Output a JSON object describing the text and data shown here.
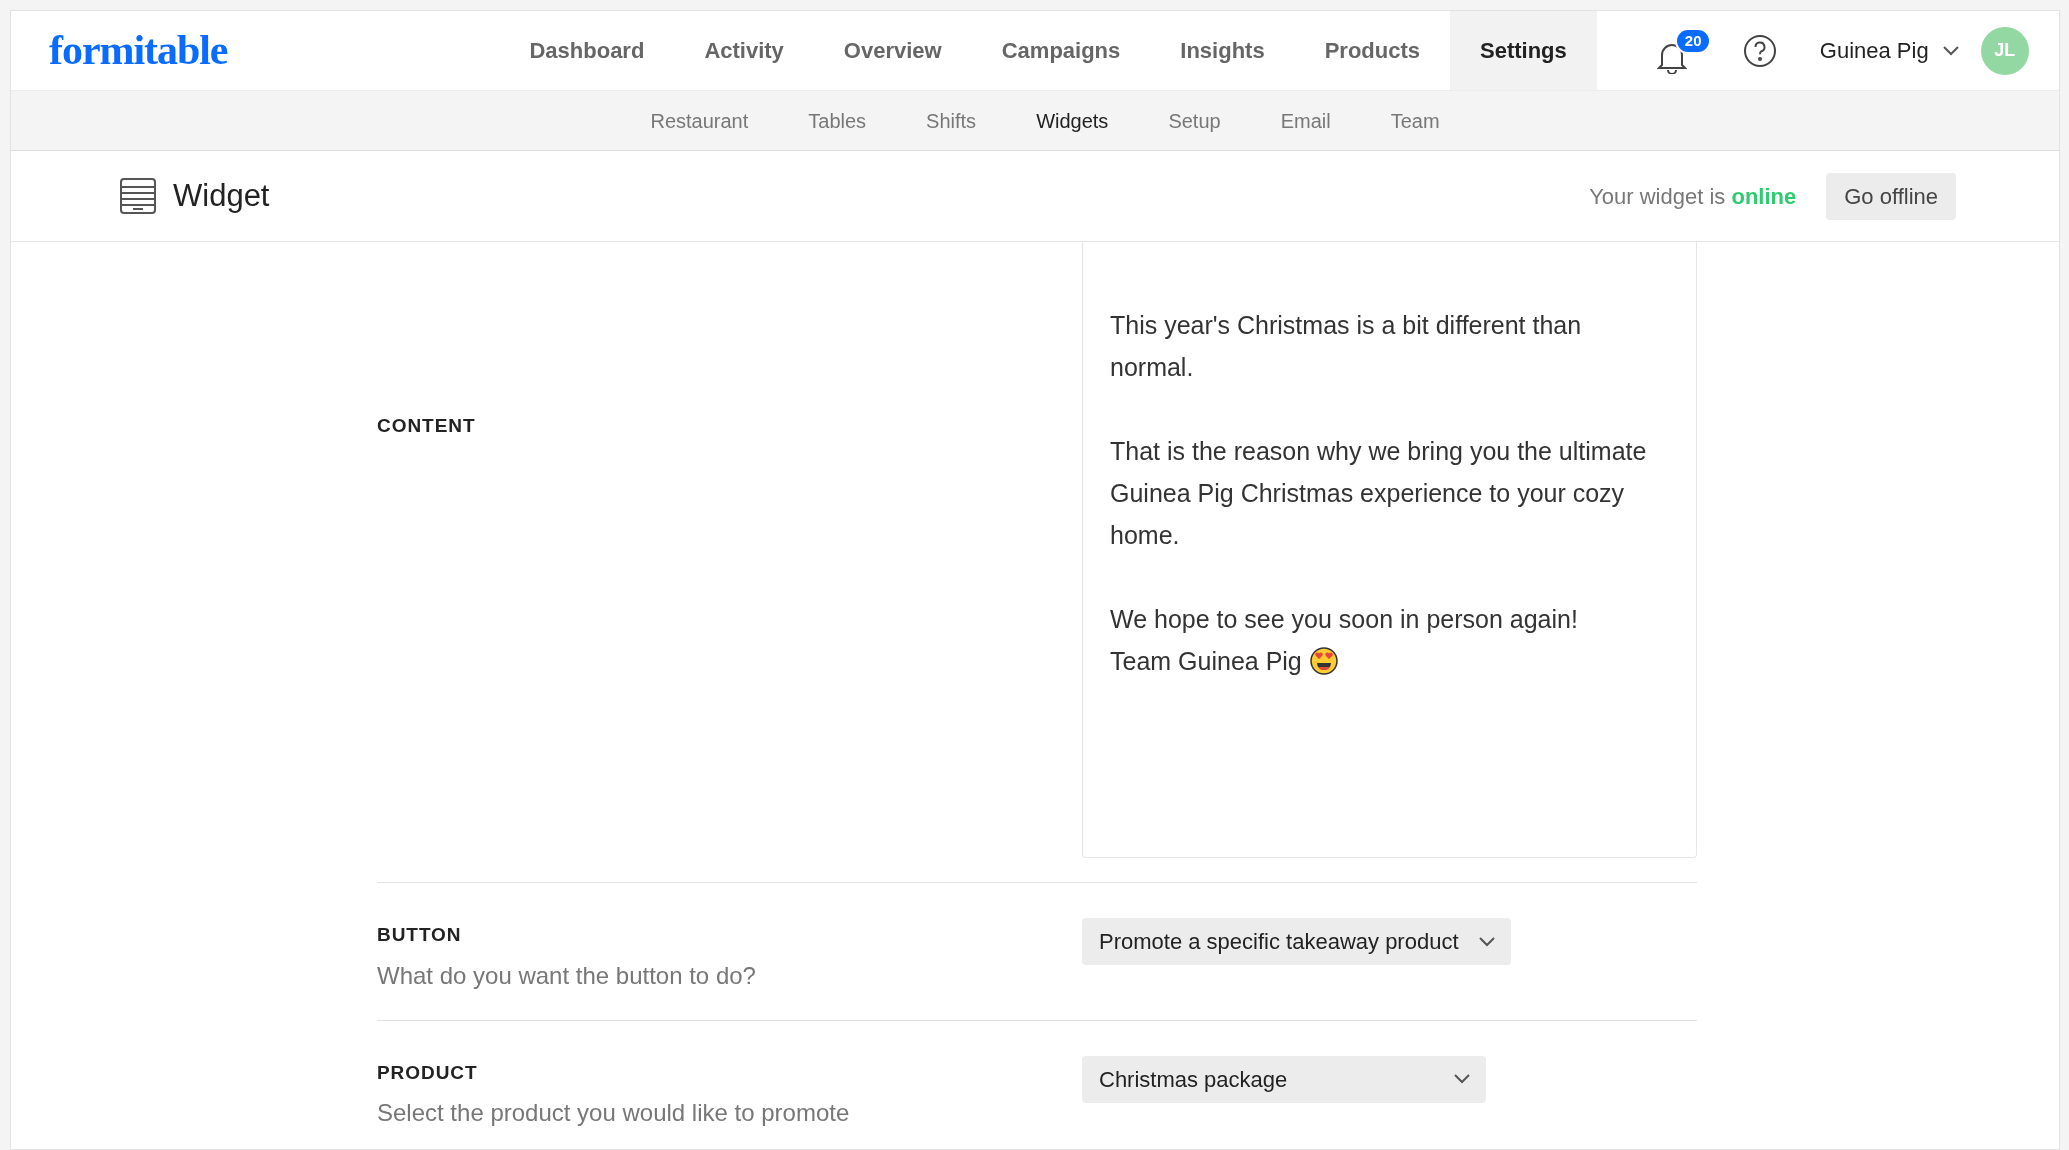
{
  "logo": "formitable",
  "nav": [
    {
      "label": "Dashboard",
      "selected": false
    },
    {
      "label": "Activity",
      "selected": false
    },
    {
      "label": "Overview",
      "selected": false
    },
    {
      "label": "Campaigns",
      "selected": false
    },
    {
      "label": "Insights",
      "selected": false
    },
    {
      "label": "Products",
      "selected": false
    },
    {
      "label": "Settings",
      "selected": true
    }
  ],
  "notifications": {
    "count": "20"
  },
  "user": {
    "name": "Guinea Pig",
    "initials": "JL"
  },
  "subnav": [
    {
      "label": "Restaurant",
      "selected": false
    },
    {
      "label": "Tables",
      "selected": false
    },
    {
      "label": "Shifts",
      "selected": false
    },
    {
      "label": "Widgets",
      "selected": true
    },
    {
      "label": "Setup",
      "selected": false
    },
    {
      "label": "Email",
      "selected": false
    },
    {
      "label": "Team",
      "selected": false
    }
  ],
  "page": {
    "title": "Widget",
    "status_text": "Your widget is",
    "status": "online",
    "action": "Go offline"
  },
  "content": {
    "label": "CONTENT",
    "paragraphs": [
      {
        "lines": [
          "This year's Christmas is a bit different than normal."
        ]
      },
      {
        "lines": [
          "That is the reason why we bring you the ultimate Guinea Pig Christmas experience to your cozy home."
        ]
      },
      {
        "lines": [
          "We hope to see you soon in person again!",
          "Team Guinea Pig"
        ],
        "emoji_after": true
      }
    ]
  },
  "settings": [
    {
      "label": "BUTTON",
      "description": "What do you want the button to do?",
      "value": "Promote a specific takeaway product"
    },
    {
      "label": "PRODUCT",
      "description": "Select the product you would like to promote",
      "value": "Christmas package"
    }
  ]
}
